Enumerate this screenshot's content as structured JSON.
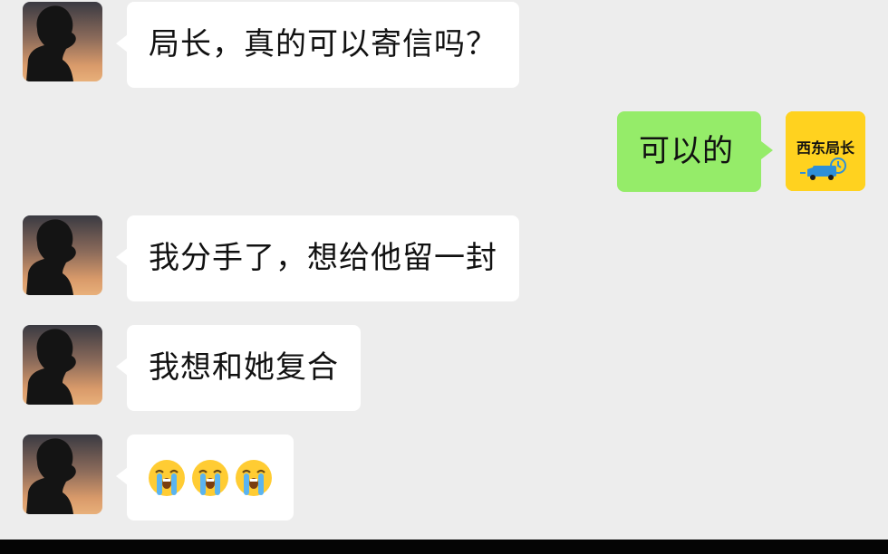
{
  "chat": {
    "messages": [
      {
        "side": "in",
        "text": "局长，真的可以寄信吗？"
      },
      {
        "side": "out",
        "text": "可以的"
      },
      {
        "side": "in",
        "text": "我分手了，想给他留一封"
      },
      {
        "side": "in",
        "text": "我想和她复合"
      },
      {
        "side": "in",
        "text": "😭😭😭",
        "emoji": "loudly-crying-face",
        "emoji_count": 3
      }
    ],
    "self_avatar_text": "西东局长"
  },
  "colors": {
    "background": "#ededed",
    "incoming_bubble": "#ffffff",
    "outgoing_bubble": "#95ec69",
    "self_avatar_bg": "#ffd21f",
    "bottom_bar": "#050505"
  },
  "icons": {
    "contact_avatar": "silhouette-sunset-avatar",
    "self_avatar": "mail-truck-logo",
    "emoji": "loudly-crying-face"
  }
}
